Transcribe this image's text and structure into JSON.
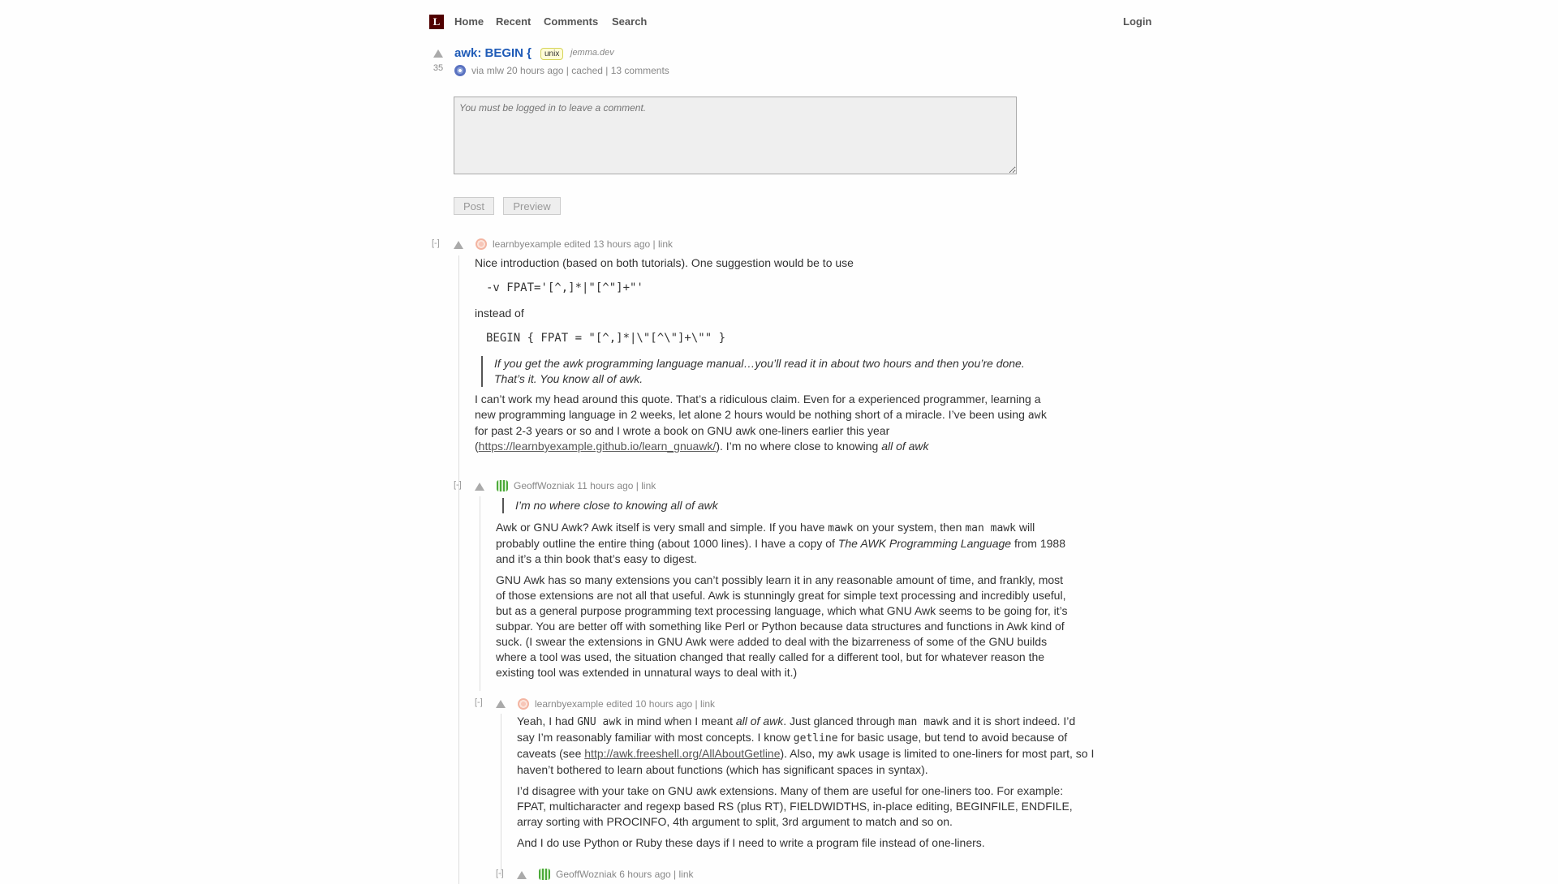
{
  "nav": {
    "logo": "L",
    "home": "Home",
    "recent": "Recent",
    "comments": "Comments",
    "search": "Search",
    "login": "Login"
  },
  "story": {
    "score": "35",
    "title": "awk: BEGIN {",
    "tag": "unix",
    "domain": "jemma.dev",
    "via": "via",
    "submitter": "mlw",
    "time": "20 hours ago",
    "sep1": "|",
    "cached": "cached",
    "sep2": "|",
    "comments": "13 comments"
  },
  "comment_box": {
    "placeholder": "You must be logged in to leave a comment."
  },
  "buttons": {
    "post": "Post",
    "preview": "Preview"
  },
  "comments": [
    {
      "toggle": "[-]",
      "author": "learnbyexample",
      "action": "edited",
      "time": "13 hours ago",
      "sep": "|",
      "link": "link",
      "p1": "Nice introduction (based on both tutorials). One suggestion would be to use",
      "code1": "-v FPAT='[^,]*|\"[^\"]+\"'",
      "p2": "instead of",
      "code2": "BEGIN { FPAT = \"[^,]*|\\\"[^\\\"]+\\\"\" }",
      "quote": "If you get the awk programming language manual…you’ll read it in about two hours and then you’re done. That’s it. You know all of awk.",
      "p3a": "I can’t work my head around this quote. That’s a ridiculous claim. Even for a experienced programmer, learning a new programming language in 2 weeks, let alone 2 hours would be nothing short of a miracle. I’ve been using",
      "p3code": "awk",
      "p3b": "for past 2-3 years or so and I wrote a book on GNU awk one-liners earlier this year (",
      "p3url": "https://learnbyexample.github.io/learn_gnuawk/",
      "p3c": "). I’m no where close to knowing",
      "p3em": "all of awk"
    },
    {
      "toggle": "[-]",
      "author": "GeoffWozniak",
      "time": "11 hours ago",
      "sep": "|",
      "link": "link",
      "quote": "I’m no where close to knowing all of awk",
      "p1a": "Awk or GNU Awk? Awk itself is very small and simple. If you have",
      "p1code1": "mawk",
      "p1b": "on your system, then",
      "p1code2": "man mawk",
      "p1c": "will probably outline the entire thing (about 1000 lines). I have a copy of",
      "p1em": "The AWK Programming Language",
      "p1d": "from 1988 and it’s a thin book that’s easy to digest.",
      "p2": "GNU Awk has so many extensions you can’t possibly learn it in any reasonable amount of time, and frankly, most of those extensions are not all that useful. Awk is stunningly great for simple text processing and incredibly useful, but as a general purpose programming text processing language, which what GNU Awk seems to be going for, it’s subpar. You are better off with something like Perl or Python because data structures and functions in Awk kind of suck. (I swear the extensions in GNU Awk were added to deal with the bizarreness of some of the GNU builds where a tool was used, the situation changed that really called for a different tool, but for whatever reason the existing tool was extended in unnatural ways to deal with it.)"
    },
    {
      "toggle": "[-]",
      "author": "learnbyexample",
      "action": "edited",
      "time": "10 hours ago",
      "sep": "|",
      "link": "link",
      "p1a": "Yeah, I had",
      "p1code1": "GNU awk",
      "p1b": "in mind when I meant",
      "p1em": "all of awk",
      "p1c": ". Just glanced through",
      "p1code2": "man mawk",
      "p1d": "and it is short indeed. I’d say I’m reasonably familiar with most concepts. I know",
      "p1code3": "getline",
      "p1e": "for basic usage, but tend to avoid because of caveats (see",
      "p1url": "http://awk.freeshell.org/AllAboutGetline",
      "p1f": "). Also, my",
      "p1code4": "awk",
      "p1g": "usage is limited to one-liners for most part, so I haven’t bothered to learn about functions (which has significant spaces in syntax).",
      "p2": "I’d disagree with your take on GNU awk extensions. Many of them are useful for one-liners too. For example: FPAT, multicharacter and regexp based RS (plus RT), FIELDWIDTHS, in-place editing, BEGINFILE, ENDFILE, array sorting with PROCINFO, 4th argument to split, 3rd argument to match and so on.",
      "p3": "And I do use Python or Ruby these days if I need to write a program file instead of one-liners."
    },
    {
      "toggle": "[-]",
      "author": "GeoffWozniak",
      "time": "6 hours ago",
      "sep": "|",
      "link": "link"
    }
  ],
  "colors": {
    "accent_title": "#1f5bb7",
    "logo_bg": "#500000",
    "tag_bg": "#fffcd7"
  }
}
